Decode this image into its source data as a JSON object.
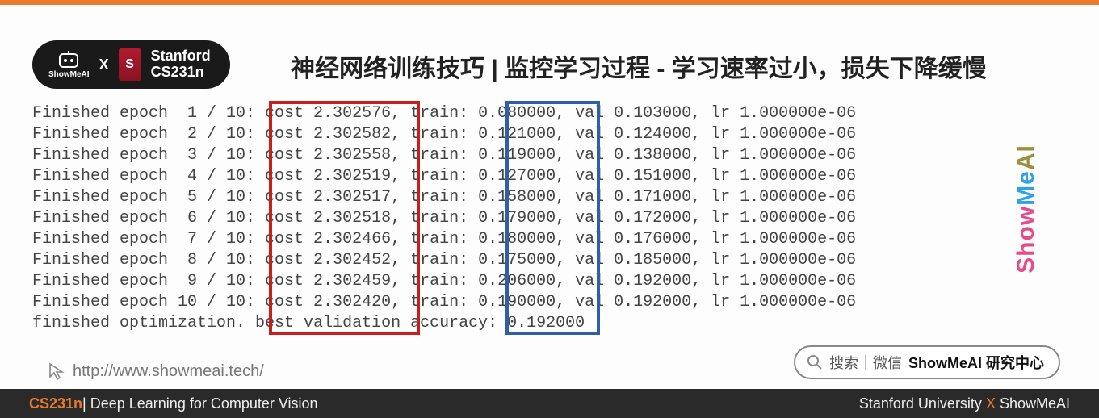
{
  "badge": {
    "logo_text": "ShowMeAI",
    "x": "X",
    "univ": "Stanford",
    "course": "CS231n"
  },
  "title": "神经网络训练技巧 | 监控学习过程 - 学习速率过小，损失下降缓慢",
  "log": {
    "rows": [
      {
        "epoch": "1",
        "total": "10",
        "cost": "2.302576",
        "train": "0.080000",
        "val": "0.103000",
        "lr": "1.000000e-06"
      },
      {
        "epoch": "2",
        "total": "10",
        "cost": "2.302582",
        "train": "0.121000",
        "val": "0.124000",
        "lr": "1.000000e-06"
      },
      {
        "epoch": "3",
        "total": "10",
        "cost": "2.302558",
        "train": "0.119000",
        "val": "0.138000",
        "lr": "1.000000e-06"
      },
      {
        "epoch": "4",
        "total": "10",
        "cost": "2.302519",
        "train": "0.127000",
        "val": "0.151000",
        "lr": "1.000000e-06"
      },
      {
        "epoch": "5",
        "total": "10",
        "cost": "2.302517",
        "train": "0.158000",
        "val": "0.171000",
        "lr": "1.000000e-06"
      },
      {
        "epoch": "6",
        "total": "10",
        "cost": "2.302518",
        "train": "0.179000",
        "val": "0.172000",
        "lr": "1.000000e-06"
      },
      {
        "epoch": "7",
        "total": "10",
        "cost": "2.302466",
        "train": "0.180000",
        "val": "0.176000",
        "lr": "1.000000e-06"
      },
      {
        "epoch": "8",
        "total": "10",
        "cost": "2.302452",
        "train": "0.175000",
        "val": "0.185000",
        "lr": "1.000000e-06"
      },
      {
        "epoch": "9",
        "total": "10",
        "cost": "2.302459",
        "train": "0.206000",
        "val": "0.192000",
        "lr": "1.000000e-06"
      },
      {
        "epoch": "10",
        "total": "10",
        "cost": "2.302420",
        "train": "0.190000",
        "val": "0.192000",
        "lr": "1.000000e-06"
      }
    ],
    "final": "finished optimization. best validation accuracy: 0.192000"
  },
  "url": "http://www.showmeai.tech/",
  "search": {
    "hint": "搜索｜微信",
    "brand": "ShowMeAI 研究中心"
  },
  "footer": {
    "left_course": "CS231n",
    "left_sep": "| ",
    "left_title": "Deep Learning for Computer Vision",
    "right_univ": "Stanford University",
    "right_x": " X ",
    "right_brand": "ShowMeAI"
  },
  "side": {
    "p1": "Show",
    "p2": "Me",
    "p3": "AI"
  }
}
